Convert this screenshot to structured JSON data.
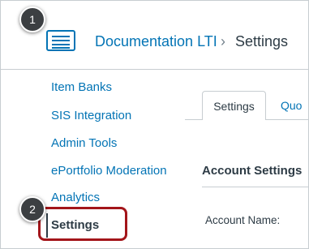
{
  "header": {
    "breadcrumb_link": "Documentation LTI",
    "breadcrumb_separator": "›",
    "breadcrumb_current": "Settings"
  },
  "sidebar": {
    "items": [
      {
        "label": "Item Banks",
        "active": false
      },
      {
        "label": "SIS Integration",
        "active": false
      },
      {
        "label": "Admin Tools",
        "active": false
      },
      {
        "label": "ePortfolio Moderation",
        "active": false
      },
      {
        "label": "Analytics",
        "active": false
      },
      {
        "label": "Settings",
        "active": true
      }
    ]
  },
  "tabs": [
    {
      "label": "Settings",
      "active": true
    },
    {
      "label": "Quo",
      "active": false
    }
  ],
  "content": {
    "section_heading": "Account Settings",
    "field_label": "Account Name:"
  },
  "callouts": [
    "1",
    "2"
  ],
  "colors": {
    "link": "#0374b5",
    "text": "#2d3b45",
    "highlight": "#a3151a",
    "callout": "#3c3f42"
  },
  "icons": {
    "menu": "hamburger-menu-icon"
  }
}
